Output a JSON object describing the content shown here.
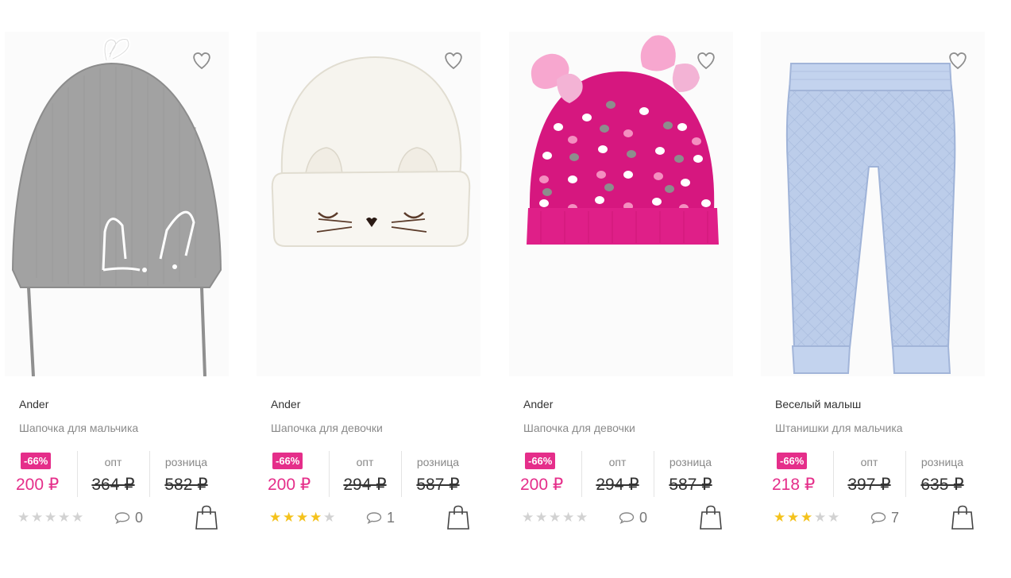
{
  "products": [
    {
      "brand": "Ander",
      "title": "Шапочка для мальчика",
      "discount": "-66%",
      "price": "200 ₽",
      "opt_label": "опт",
      "opt_price": "364 ₽",
      "retail_label": "розница",
      "retail_price": "582 ₽",
      "rating": 0,
      "comments": "0",
      "image": "grey-knit-hat-bunny",
      "colors": {
        "main": "#9d9d9d"
      }
    },
    {
      "brand": "Ander",
      "title": "Шапочка для девочки",
      "discount": "-66%",
      "price": "200 ₽",
      "opt_label": "опт",
      "opt_price": "294 ₽",
      "retail_label": "розница",
      "retail_price": "587 ₽",
      "rating": 4,
      "comments": "1",
      "image": "white-hat-cat-face",
      "colors": {
        "main": "#f4f1ea"
      }
    },
    {
      "brand": "Ander",
      "title": "Шапочка для девочки",
      "discount": "-66%",
      "price": "200 ₽",
      "opt_label": "опт",
      "opt_price": "294 ₽",
      "retail_label": "розница",
      "retail_price": "587 ₽",
      "rating": 0,
      "comments": "0",
      "image": "pink-dotted-hat-bows",
      "colors": {
        "main": "#d6177f"
      }
    },
    {
      "brand": "Веселый малыш",
      "title": "Штанишки для мальчика",
      "discount": "-66%",
      "price": "218 ₽",
      "opt_label": "опт",
      "opt_price": "397 ₽",
      "retail_label": "розница",
      "retail_price": "635 ₽",
      "rating": 3,
      "comments": "7",
      "image": "light-blue-quilted-pants",
      "colors": {
        "main": "#b9cbe6"
      }
    }
  ],
  "icons": {
    "favorite": "heart-icon",
    "comment": "comment-icon",
    "cart": "shopping-bag-icon",
    "star": "star-icon"
  },
  "accent_color": "#e52e8a",
  "star_color": "#f4c21c"
}
